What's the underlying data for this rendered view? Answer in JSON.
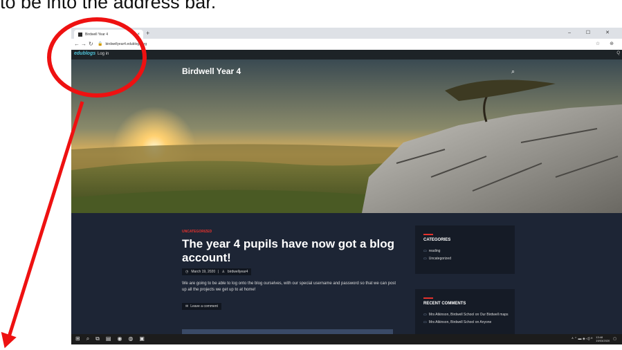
{
  "caption": "to be into the address bar.",
  "browser": {
    "tab_title": "Birdwell Year 4",
    "tab_close": "×",
    "new_tab": "+",
    "url": "birdwellyear4.edublogs.org",
    "window_controls": "– ☐ ✕",
    "addr_icons": "☆ ⊕"
  },
  "adminbar": {
    "logo": "edublogs",
    "login": "Log in",
    "right_icon": "Q"
  },
  "site": {
    "title": "Birdwell Year 4",
    "search_icon": "⌕"
  },
  "post": {
    "category": "UNCATEGORIZED",
    "title": "The year 4 pupils have now got a blog account!",
    "date": "March 19, 2020",
    "author": "birdwellyear4",
    "excerpt": "We are going to be able to log onto the blog ourselves, with our special username and password so that we can post up all the projects we get up to at home!",
    "leave_comment": "Leave a comment"
  },
  "sidebar": {
    "categories_title": "CATEGORIES",
    "categories": [
      "reading",
      "Uncategorized"
    ],
    "recent_title": "RECENT COMMENTS",
    "recent": [
      "Mrs Atkinson, Birdwell School on Our Birdwell maps",
      "Mrs Atkinson, Birdwell School on Anyone"
    ]
  },
  "taskbar": {
    "clock_time": "13:48",
    "clock_date": "19/03/2020"
  },
  "colors": {
    "accent": "#e5322d",
    "annotation": "#ee1111",
    "background": "#1d2535"
  }
}
